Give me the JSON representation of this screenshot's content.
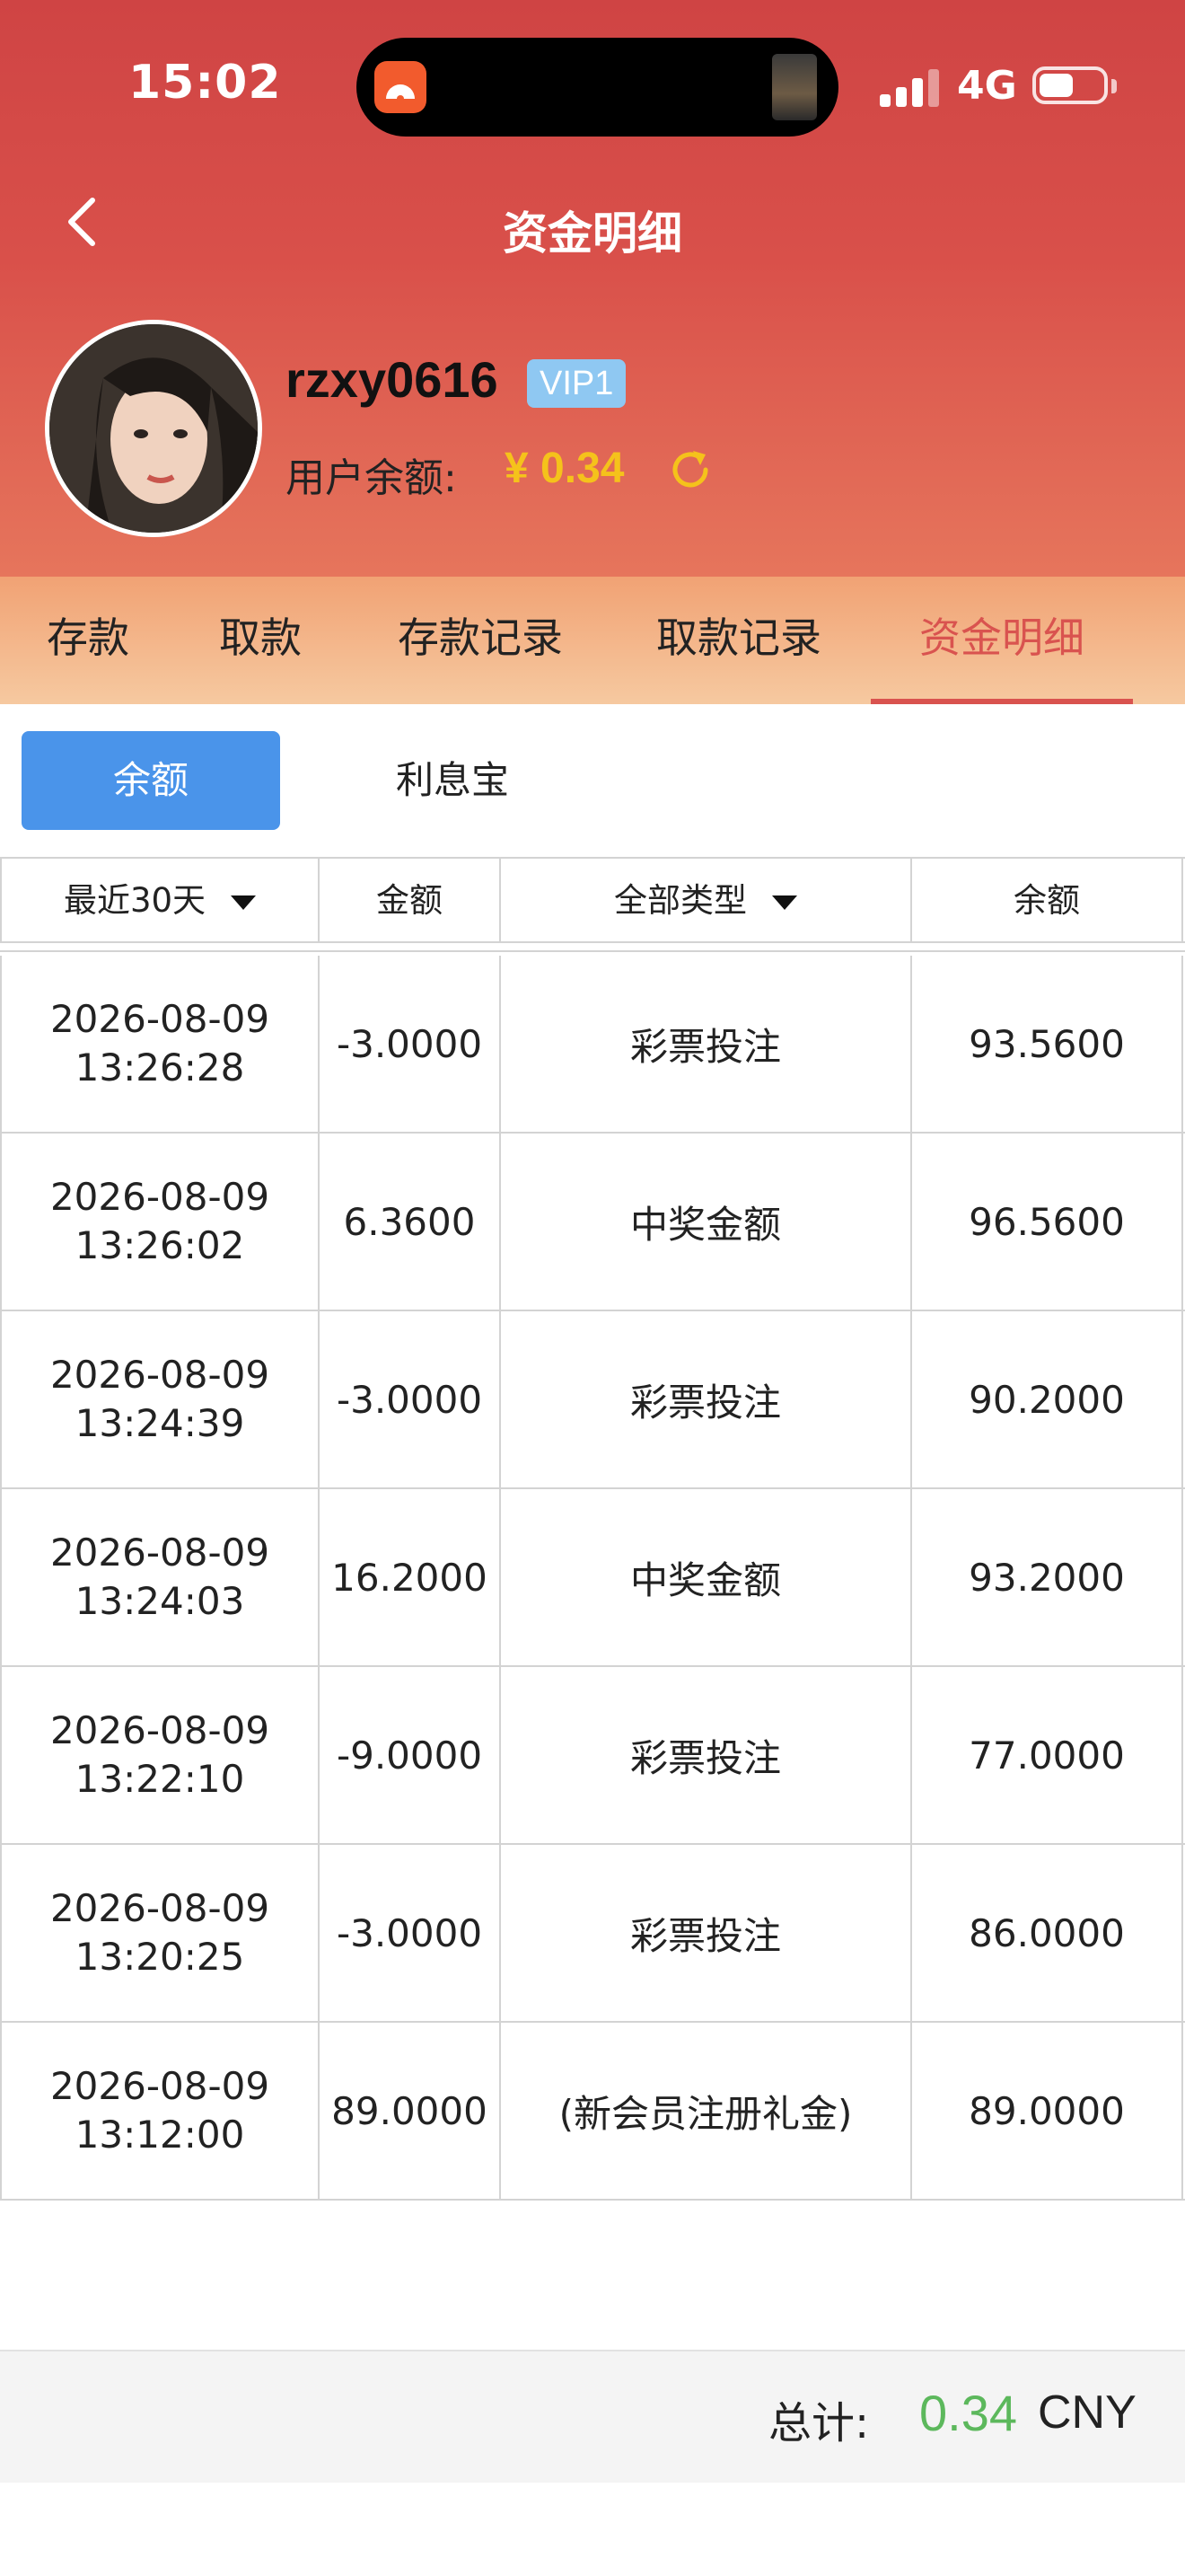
{
  "status": {
    "time": "15:02",
    "network": "4G",
    "battery_level": 0.55
  },
  "nav": {
    "title": "资金明细"
  },
  "profile": {
    "username": "rzxy0616",
    "vip": "VIP1",
    "balance_label": "用户余额:",
    "balance_value": "¥ 0.34"
  },
  "tabs": [
    "存款",
    "取款",
    "存款记录",
    "取款记录",
    "资金明细"
  ],
  "active_tab": "资金明细",
  "sub_tabs": {
    "active": "余额",
    "inactive": "利息宝"
  },
  "table": {
    "headers": {
      "date": "最近30天",
      "amount": "金额",
      "type": "全部类型",
      "balance": "余额"
    },
    "rows": [
      {
        "date": "2026-08-09",
        "time": "13:26:28",
        "amount": "-3.0000",
        "type": "彩票投注",
        "balance": "93.5600"
      },
      {
        "date": "2026-08-09",
        "time": "13:26:02",
        "amount": "6.3600",
        "type": "中奖金额",
        "balance": "96.5600"
      },
      {
        "date": "2026-08-09",
        "time": "13:24:39",
        "amount": "-3.0000",
        "type": "彩票投注",
        "balance": "90.2000"
      },
      {
        "date": "2026-08-09",
        "time": "13:24:03",
        "amount": "16.2000",
        "type": "中奖金额",
        "balance": "93.2000"
      },
      {
        "date": "2026-08-09",
        "time": "13:22:10",
        "amount": "-9.0000",
        "type": "彩票投注",
        "balance": "77.0000"
      },
      {
        "date": "2026-08-09",
        "time": "13:20:25",
        "amount": "-3.0000",
        "type": "彩票投注",
        "balance": "86.0000"
      },
      {
        "date": "2026-08-09",
        "time": "13:12:00",
        "amount": "89.0000",
        "type": "(新会员注册礼金)",
        "balance": "89.0000"
      }
    ]
  },
  "footer": {
    "total_label": "总计:",
    "total_value": "0.34",
    "currency": "CNY"
  },
  "colors": {
    "header_red": "#cf4444",
    "accent_red": "#d9534f",
    "gold": "#f5c21b",
    "blue": "#4a94ea",
    "green": "#5cb85c"
  }
}
